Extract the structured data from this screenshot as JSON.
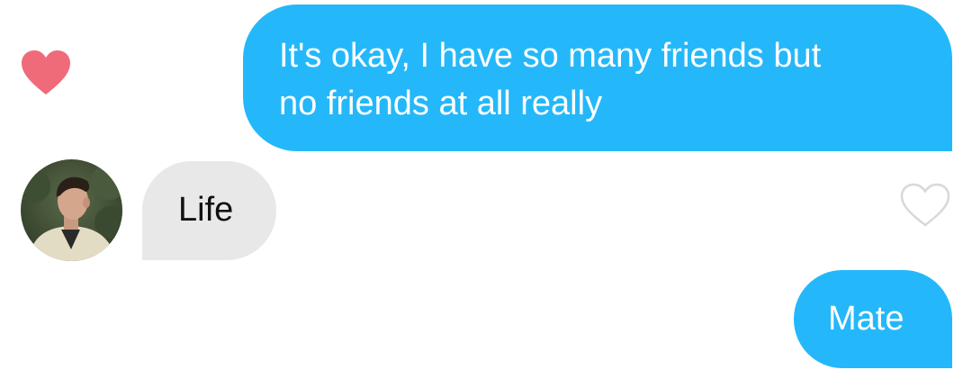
{
  "messages": [
    {
      "direction": "outgoing",
      "lines": [
        "It's okay, I have so many friends but",
        "no friends at all really"
      ],
      "liked": true
    },
    {
      "direction": "incoming",
      "text": "Life",
      "liked": false
    },
    {
      "direction": "outgoing",
      "text": "Mate"
    }
  ],
  "colors": {
    "outgoing_bubble": "#24b8fa",
    "incoming_bubble": "#e8e8e8",
    "like_heart": "#ef6b7a",
    "outline_heart": "#d8d8d8"
  },
  "icons": {
    "liked": "heart-filled-icon",
    "unliked": "heart-outline-icon"
  }
}
